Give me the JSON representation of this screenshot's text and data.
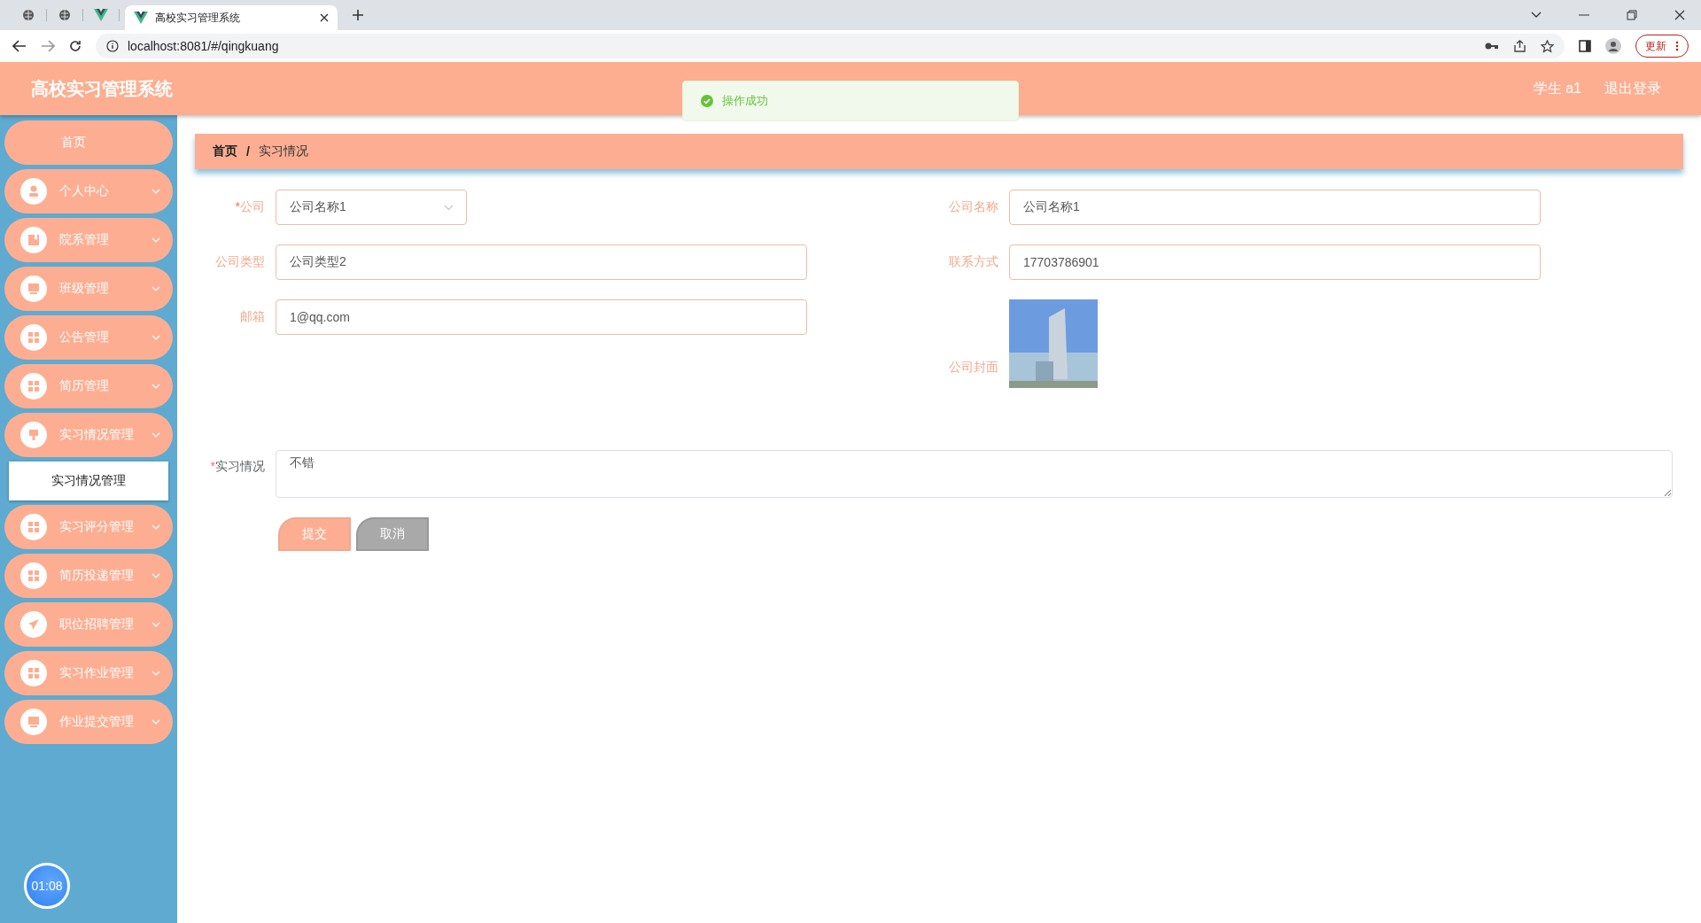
{
  "browser": {
    "tabs": [
      {
        "title": "高校实习管理系统",
        "selected": true
      }
    ],
    "address": "localhost:8081/#/qingkuang",
    "update_button": "更新"
  },
  "header": {
    "title": "高校实习管理系统",
    "user": "学生 a1",
    "logout": "退出登录"
  },
  "toast": {
    "message": "操作成功"
  },
  "sidebar": {
    "items": [
      {
        "label": "首页",
        "kind": "link"
      },
      {
        "label": "个人中心",
        "kind": "submenu"
      },
      {
        "label": "院系管理",
        "kind": "submenu"
      },
      {
        "label": "班级管理",
        "kind": "submenu"
      },
      {
        "label": "公告管理",
        "kind": "submenu"
      },
      {
        "label": "简历管理",
        "kind": "submenu"
      },
      {
        "label": "实习情况管理",
        "kind": "submenu",
        "children": [
          {
            "label": "实习情况管理"
          }
        ]
      },
      {
        "label": "实习评分管理",
        "kind": "submenu"
      },
      {
        "label": "简历投递管理",
        "kind": "submenu"
      },
      {
        "label": "职位招聘管理",
        "kind": "submenu"
      },
      {
        "label": "实习作业管理",
        "kind": "submenu"
      },
      {
        "label": "作业提交管理",
        "kind": "submenu"
      }
    ]
  },
  "timer": "01:08",
  "breadcrumb": [
    "首页",
    "实习情况"
  ],
  "breadcrumb_separator": "/",
  "form": {
    "fields": [
      {
        "label": "公司",
        "required_mark": "*",
        "kind": "select",
        "value": "公司名称1"
      },
      {
        "label": "公司名称",
        "kind": "input",
        "value": "公司名称1"
      },
      {
        "label": "公司类型",
        "kind": "input",
        "value": "公司类型2"
      },
      {
        "label": "联系方式",
        "kind": "input",
        "value": "17703786901"
      },
      {
        "label": "邮箱",
        "kind": "input",
        "value": "1@qq.com"
      },
      {
        "label": "公司封面",
        "kind": "image"
      },
      {
        "label": "实习情况",
        "required_mark": "*",
        "kind": "textarea",
        "value": "不错"
      }
    ],
    "buttons": [
      {
        "label": "提交",
        "kind": "primary"
      },
      {
        "label": "取消",
        "kind": "secondary"
      }
    ]
  }
}
